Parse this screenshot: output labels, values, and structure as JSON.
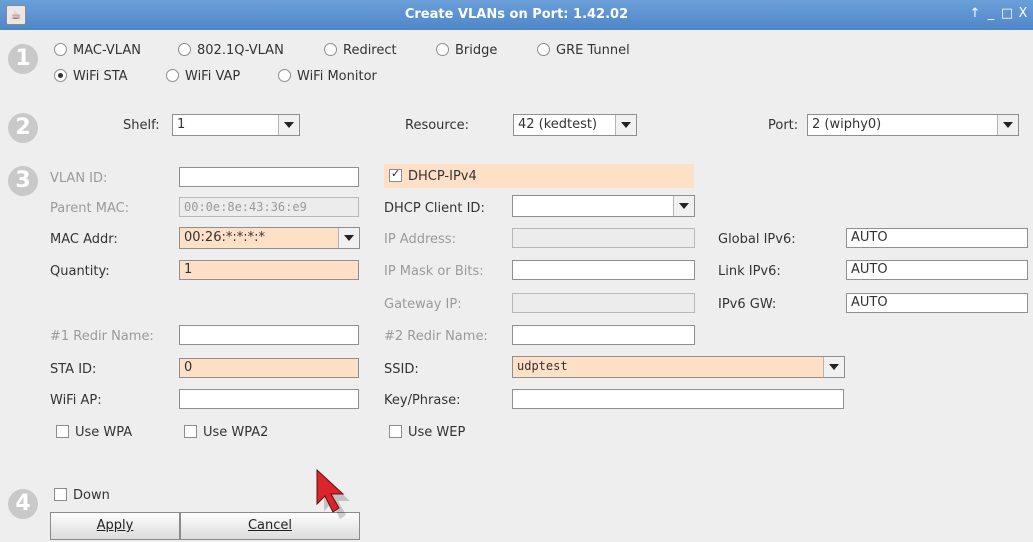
{
  "window": {
    "title": "Create VLANs on Port: 1.42.02",
    "controls": [
      "↑",
      "_",
      "□",
      "X"
    ]
  },
  "steps": [
    "1",
    "2",
    "3",
    "4"
  ],
  "type_options": [
    {
      "label": "MAC-VLAN",
      "selected": false
    },
    {
      "label": "802.1Q-VLAN",
      "selected": false
    },
    {
      "label": "Redirect",
      "selected": false
    },
    {
      "label": "Bridge",
      "selected": false
    },
    {
      "label": "GRE Tunnel",
      "selected": false
    },
    {
      "label": "WiFi STA",
      "selected": true
    },
    {
      "label": "WiFi VAP",
      "selected": false
    },
    {
      "label": "WiFi Monitor",
      "selected": false
    }
  ],
  "location": {
    "shelf_label": "Shelf:",
    "shelf_value": "1",
    "resource_label": "Resource:",
    "resource_value": "42 (kedtest)",
    "port_label": "Port:",
    "port_value": "2 (wiphy0)"
  },
  "form": {
    "vlan_id_label": "VLAN ID:",
    "vlan_id_value": "",
    "parent_mac_label": "Parent MAC:",
    "parent_mac_value": "00:0e:8e:43:36:e9",
    "mac_addr_label": "MAC Addr:",
    "mac_addr_value": "00:26:*:*:*:*",
    "quantity_label": "Quantity:",
    "quantity_value": "1",
    "redir1_label": "#1 Redir Name:",
    "redir1_value": "",
    "sta_id_label": "STA ID:",
    "sta_id_value": "0",
    "wifi_ap_label": "WiFi AP:",
    "wifi_ap_value": "",
    "use_wpa_label": "Use WPA",
    "use_wpa2_label": "Use WPA2",
    "dhcp_label": "DHCP-IPv4",
    "dhcp_checked": true,
    "dhcp_client_id_label": "DHCP Client ID:",
    "dhcp_client_id_value": "",
    "ip_address_label": "IP Address:",
    "ip_address_value": "",
    "ip_mask_label": "IP Mask or Bits:",
    "ip_mask_value": "",
    "gateway_label": "Gateway IP:",
    "gateway_value": "",
    "redir2_label": "#2 Redir Name:",
    "redir2_value": "",
    "ssid_label": "SSID:",
    "ssid_value": "udptest",
    "key_label": "Key/Phrase:",
    "key_value": "",
    "use_wep_label": "Use WEP",
    "global_ipv6_label": "Global IPv6:",
    "global_ipv6_value": "AUTO",
    "link_ipv6_label": "Link IPv6:",
    "link_ipv6_value": "AUTO",
    "ipv6_gw_label": "IPv6 GW:",
    "ipv6_gw_value": "AUTO"
  },
  "bottom": {
    "down_label": "Down",
    "apply_label": "Apply",
    "cancel_label": "Cancel"
  },
  "colors": {
    "titlebar": "#5a8fd0",
    "highlight": "#fde0c6"
  }
}
